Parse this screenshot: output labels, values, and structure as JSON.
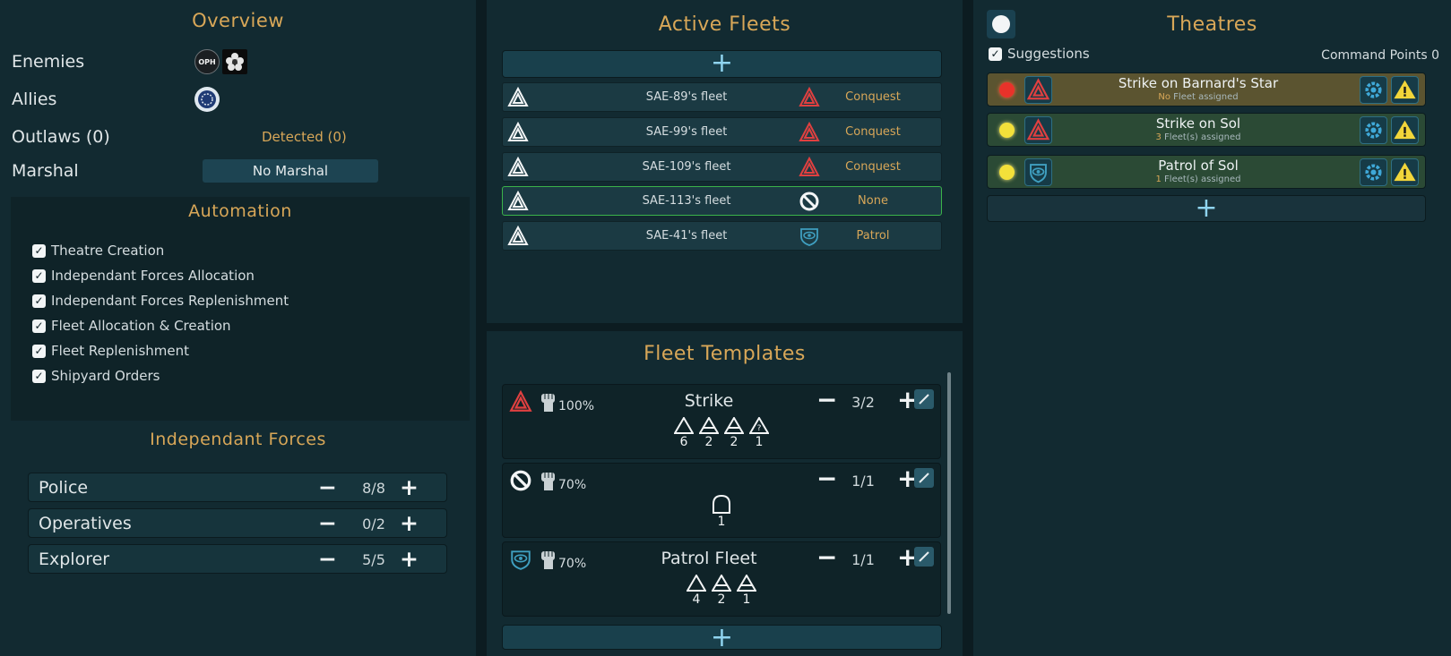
{
  "overview": {
    "title": "Overview",
    "enemies_label": "Enemies",
    "enemy_emblems": [
      "OPH",
      "flower-emblem-icon"
    ],
    "allies_label": "Allies",
    "ally_emblems": [
      "ring-emblem-icon"
    ],
    "outlaws_label": "Outlaws (0)",
    "detected_label": "Detected (0)",
    "marshal_label": "Marshal",
    "marshal_value": "No Marshal"
  },
  "automation": {
    "title": "Automation",
    "options": [
      {
        "label": "Theatre Creation",
        "checked": true
      },
      {
        "label": "Independant Forces Allocation",
        "checked": true
      },
      {
        "label": "Independant Forces Replenishment",
        "checked": true
      },
      {
        "label": "Fleet Allocation & Creation",
        "checked": true
      },
      {
        "label": "Fleet Replenishment",
        "checked": true
      },
      {
        "label": "Shipyard Orders",
        "checked": true
      }
    ]
  },
  "independant_forces": {
    "title": "Independant Forces",
    "rows": [
      {
        "name": "Police",
        "count": "8/8"
      },
      {
        "name": "Operatives",
        "count": "0/2"
      },
      {
        "name": "Explorer",
        "count": "5/5"
      }
    ]
  },
  "active_fleets": {
    "title": "Active Fleets",
    "add_label": "+",
    "rows": [
      {
        "name": "SAE-89's fleet",
        "mission": "Conquest",
        "mission_icon": "strike-icon",
        "selected": false
      },
      {
        "name": "SAE-99's fleet",
        "mission": "Conquest",
        "mission_icon": "strike-icon",
        "selected": false
      },
      {
        "name": "SAE-109's fleet",
        "mission": "Conquest",
        "mission_icon": "strike-icon",
        "selected": false
      },
      {
        "name": "SAE-113's fleet",
        "mission": "None",
        "mission_icon": "none-icon",
        "selected": true
      },
      {
        "name": "SAE-41's fleet",
        "mission": "Patrol",
        "mission_icon": "patrol-eye-icon",
        "selected": false
      }
    ]
  },
  "fleet_templates": {
    "title": "Fleet Templates",
    "add_label": "+",
    "cards": [
      {
        "name": "Strike",
        "pct": "100%",
        "count": "3/2",
        "minus": "−",
        "plus": "+",
        "ships": [
          "6",
          "2",
          "2",
          "1"
        ]
      },
      {
        "name": "",
        "pct": "70%",
        "count": "1/1",
        "minus": "−",
        "plus": "+",
        "ships": [
          "1"
        ]
      },
      {
        "name": "Patrol Fleet",
        "pct": "70%",
        "count": "1/1",
        "minus": "−",
        "plus": "+",
        "ships": [
          "4",
          "2",
          "1"
        ]
      }
    ]
  },
  "theatres": {
    "title": "Theatres",
    "suggestions_label": "Suggestions",
    "command_points": "Command Points 0",
    "add_label": "+",
    "rows": [
      {
        "title": "Strike on Barnard's Star",
        "count": "No",
        "sub": " Fleet assigned",
        "status_color": "#e8322a",
        "bg": "#5b5430"
      },
      {
        "title": "Strike on Sol",
        "count": "3",
        "sub": " Fleet(s) assigned",
        "status_color": "#f3e03a",
        "bg": "#2b4a35"
      },
      {
        "title": "Patrol of Sol",
        "count": "1",
        "sub": " Fleet(s) assigned",
        "status_color": "#f3e03a",
        "bg": "#2b4a35"
      }
    ]
  },
  "icons": {
    "minus": "−",
    "plus": "+"
  }
}
